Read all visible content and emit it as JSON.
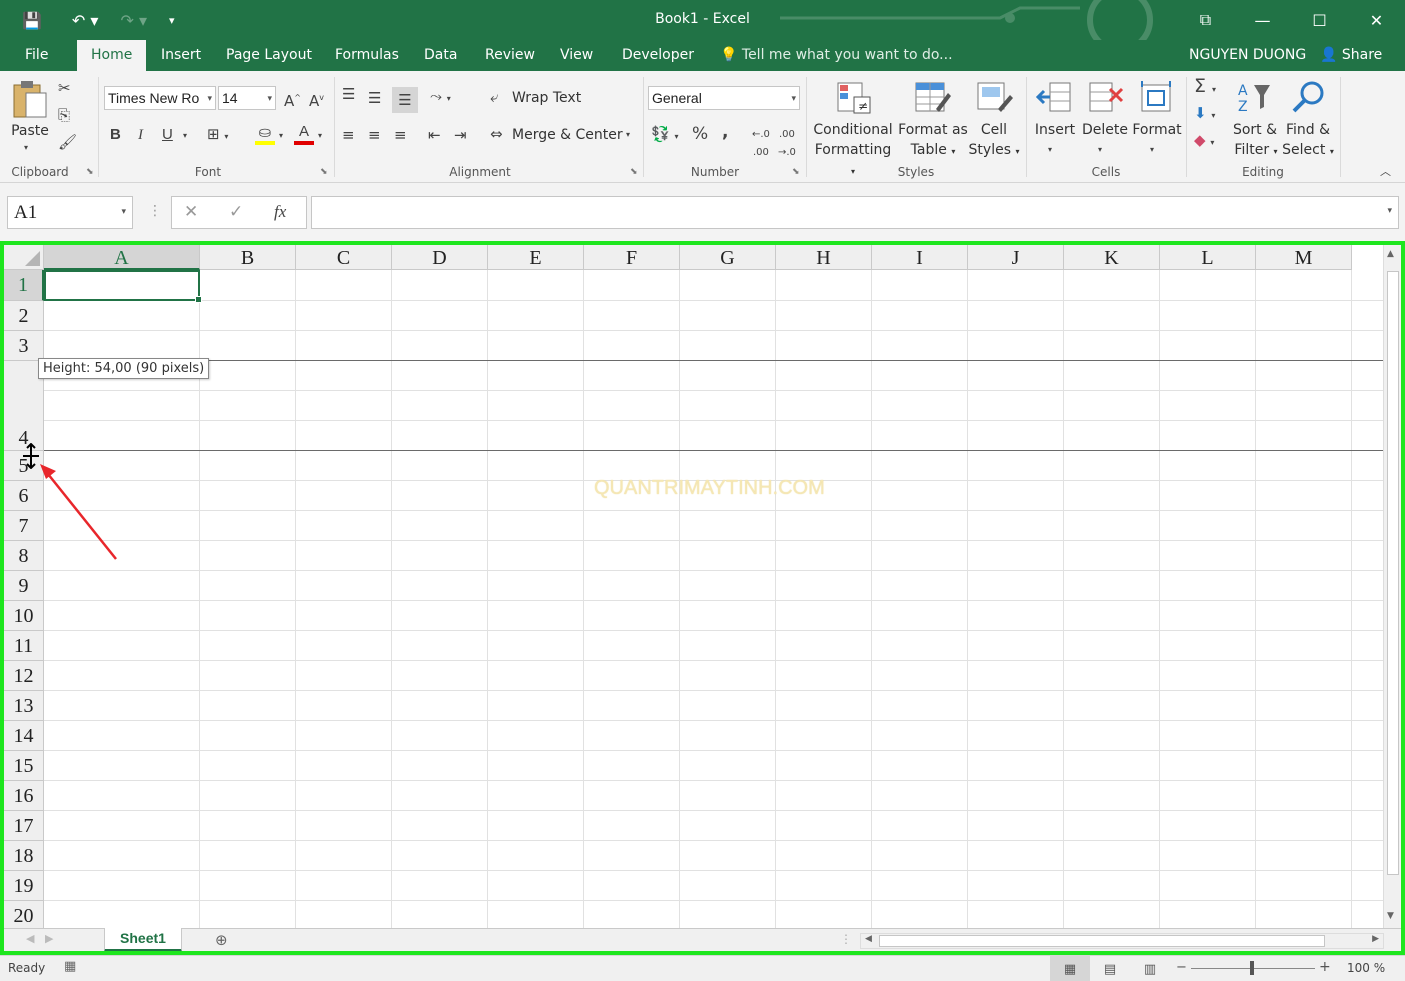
{
  "window": {
    "title": "Book1 - Excel",
    "user": "NGUYEN DUONG",
    "share_label": "Share",
    "tell_me_placeholder": "Tell me what you want to do..."
  },
  "tabs": [
    {
      "label": "File"
    },
    {
      "label": "Home",
      "active": true
    },
    {
      "label": "Insert"
    },
    {
      "label": "Page Layout"
    },
    {
      "label": "Formulas"
    },
    {
      "label": "Data"
    },
    {
      "label": "Review"
    },
    {
      "label": "View"
    },
    {
      "label": "Developer"
    }
  ],
  "ribbon": {
    "clipboard": {
      "label": "Clipboard",
      "paste": "Paste"
    },
    "font": {
      "label": "Font",
      "name": "Times New Ro",
      "size": "14",
      "bold": "B",
      "italic": "I",
      "underline": "U"
    },
    "alignment": {
      "label": "Alignment",
      "wrap_text": "Wrap Text",
      "merge_center": "Merge & Center"
    },
    "number": {
      "label": "Number",
      "format": "General",
      "percent": "%",
      "comma": ","
    },
    "styles": {
      "label": "Styles",
      "conditional_1": "Conditional",
      "conditional_2": "Formatting",
      "format_table_1": "Format as",
      "format_table_2": "Table",
      "cell_styles_1": "Cell",
      "cell_styles_2": "Styles"
    },
    "cells": {
      "label": "Cells",
      "insert": "Insert",
      "delete": "Delete",
      "format": "Format"
    },
    "editing": {
      "label": "Editing",
      "sort_1": "Sort &",
      "sort_2": "Filter",
      "find_1": "Find &",
      "find_2": "Select"
    }
  },
  "formula_bar": {
    "name_box": "A1",
    "fx": "fx",
    "value": ""
  },
  "sheet": {
    "columns": [
      "A",
      "B",
      "C",
      "D",
      "E",
      "F",
      "G",
      "H",
      "I",
      "J",
      "K",
      "L",
      "M"
    ],
    "rows": [
      "1",
      "2",
      "3",
      "4",
      "5",
      "6",
      "7",
      "8",
      "9",
      "10",
      "11",
      "12",
      "13",
      "14",
      "15",
      "16",
      "17",
      "18",
      "19",
      "20"
    ],
    "active_cell": "A1",
    "tooltip": "Height: 54,00 (90 pixels)",
    "watermark": "QUANTRIMAYTINH.COM",
    "sheet_tab": "Sheet1"
  },
  "status": {
    "ready": "Ready",
    "zoom": "100 %"
  },
  "colors": {
    "excel_green": "#217346",
    "highlight_border": "#1ee61e",
    "annotation_arrow": "#e8262b"
  }
}
